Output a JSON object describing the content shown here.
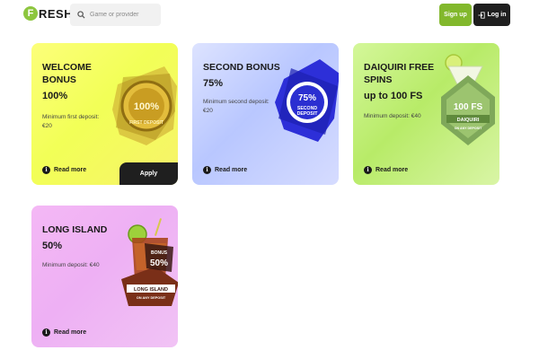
{
  "header": {
    "logo_letter": "F",
    "logo_text": "RESH",
    "search_placeholder": "Game or provider",
    "signup_label": "Sign up",
    "login_label": "Log in"
  },
  "cards": [
    {
      "title": "WELCOME BONUS",
      "amount": "100%",
      "desc": "Minimum first deposit: €20",
      "read_more": "Read more",
      "apply": "Apply",
      "badge_value": "100%",
      "badge_text": "FIRST DEPOSIT"
    },
    {
      "title": "SECOND BONUS",
      "amount": "75%",
      "desc": "Minimum second deposit: €20",
      "read_more": "Read more",
      "badge_value": "75%",
      "badge_text1": "SECOND",
      "badge_text2": "DEPOSIT"
    },
    {
      "title": "DAIQUIRI FREE SPINS",
      "amount": "up to 100 FS",
      "desc": "Minimum deposit: €40",
      "read_more": "Read more",
      "badge_value": "100 FS",
      "badge_text1": "DAIQUIRI",
      "badge_text2": "ON ANY DEPOSIT"
    },
    {
      "title": "LONG ISLAND",
      "amount": "50%",
      "desc": "Minimum deposit: €40",
      "read_more": "Read more",
      "badge_small": "BONUS",
      "badge_value": "50%",
      "badge_text1": "LONG ISLAND",
      "badge_text2": "ON ANY DEPOSIT"
    }
  ],
  "info_glyph": "i",
  "colors": {
    "accent_green": "#82b82c",
    "dark": "#1f1f1f"
  }
}
